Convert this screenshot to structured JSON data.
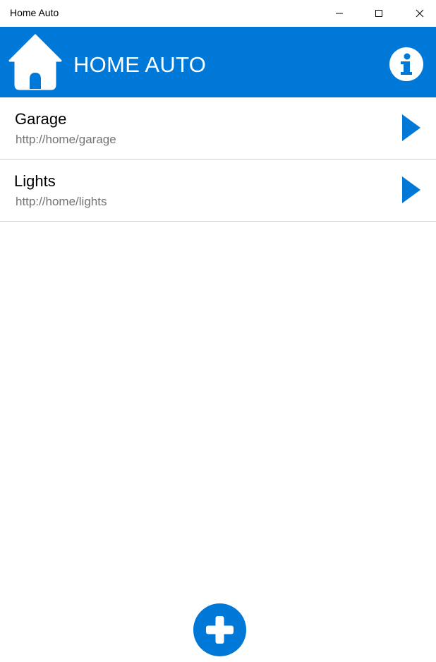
{
  "window": {
    "title": "Home Auto",
    "controls": [
      "minimize",
      "maximize",
      "close"
    ]
  },
  "header": {
    "logo_icon": "home-icon",
    "title": "HOME AUTO",
    "info_icon": "info-icon",
    "background_color": "#0078d7"
  },
  "devices": [
    {
      "name": "Garage",
      "url": "http://home/garage",
      "action_icon": "play-icon"
    },
    {
      "name": "Lights",
      "url": "http://home/lights",
      "action_icon": "play-icon"
    }
  ],
  "footer": {
    "add_icon": "add-icon",
    "accent_color": "#0078d7"
  }
}
